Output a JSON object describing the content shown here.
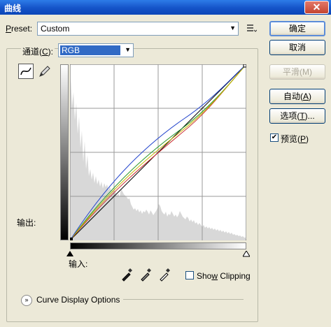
{
  "window": {
    "title": "曲线",
    "close_label": "✕"
  },
  "preset": {
    "label_prefix": "P",
    "label_rest": "reset:",
    "value": "Custom"
  },
  "buttons": {
    "ok": "确定",
    "cancel": "取消",
    "smooth": "平滑(M)",
    "auto_text": "自动(",
    "auto_key": "A",
    "auto_end": ")",
    "options_text": "选项(",
    "options_key": "T",
    "options_end": ")..."
  },
  "preview": {
    "text": "预览(",
    "key": "P",
    "end": ")",
    "checked": true
  },
  "channel": {
    "label_text": "通道(",
    "label_key": "C",
    "label_end": "):",
    "value": "RGB"
  },
  "output_label": "输出:",
  "input_label": "输入:",
  "show_clipping": {
    "pre": "Sho",
    "key": "w",
    "post": " Clipping",
    "checked": false
  },
  "curve_display_options": "Curve Display Options",
  "curve_colors": {
    "blue": "#2244cc",
    "green": "#2a9a2a",
    "yellow": "#c8b400",
    "red": "#cc3333",
    "baseline": "#000000"
  }
}
